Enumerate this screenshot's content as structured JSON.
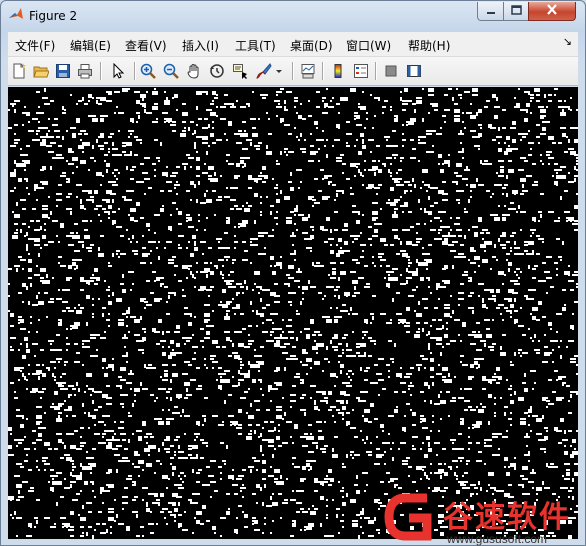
{
  "window": {
    "title": "Figure 2",
    "controls": {
      "minimize": "minimize",
      "maximize": "maximize",
      "close": "close"
    }
  },
  "menu": {
    "items": [
      "文件(F)",
      "编辑(E)",
      "查看(V)",
      "插入(I)",
      "工具(T)",
      "桌面(D)",
      "窗口(W)",
      "帮助(H)"
    ],
    "overflow_glyph": "↘"
  },
  "toolbar": {
    "buttons": [
      "new-figure",
      "open-file",
      "save-figure",
      "print-figure",
      "edit-plot-arrow",
      "zoom-in",
      "zoom-out",
      "pan-hand",
      "rotate-3d",
      "data-cursor",
      "brush",
      "brush-dropdown",
      "link-plot",
      "colorbar",
      "legend",
      "hide-plot-tools",
      "show-plot-tools"
    ]
  },
  "figure": {
    "content": "random binary noise image",
    "background_color": "#000000",
    "foreground_color": "#ffffff"
  },
  "watermark": {
    "text": "谷速软件",
    "url": "www.gususoft.com",
    "color": "#e8322d"
  }
}
